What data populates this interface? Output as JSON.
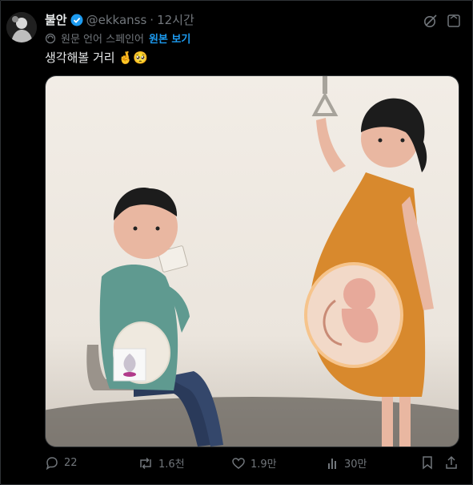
{
  "author": {
    "name": "불안",
    "handle": "@ekkanss",
    "separator": "·",
    "time": "12시간"
  },
  "translation": {
    "note": "원문 언어 스페인어",
    "show_original": "원본 보기"
  },
  "tweet": {
    "text": "생각해볼 거리",
    "emoji": "🤞🥺"
  },
  "actions": {
    "replies": "22",
    "reposts": "1.6천",
    "likes": "1.9만",
    "views": "30만"
  },
  "icons": [
    "verified-badge-icon",
    "grok-icon",
    "more-icon",
    "translate-icon",
    "reply-icon",
    "repost-icon",
    "like-icon",
    "views-icon",
    "bookmark-icon",
    "share-icon"
  ],
  "colors": {
    "background": "#000000",
    "accent": "#1d9bf0",
    "muted": "#71767b",
    "text": "#e7e9ea"
  }
}
